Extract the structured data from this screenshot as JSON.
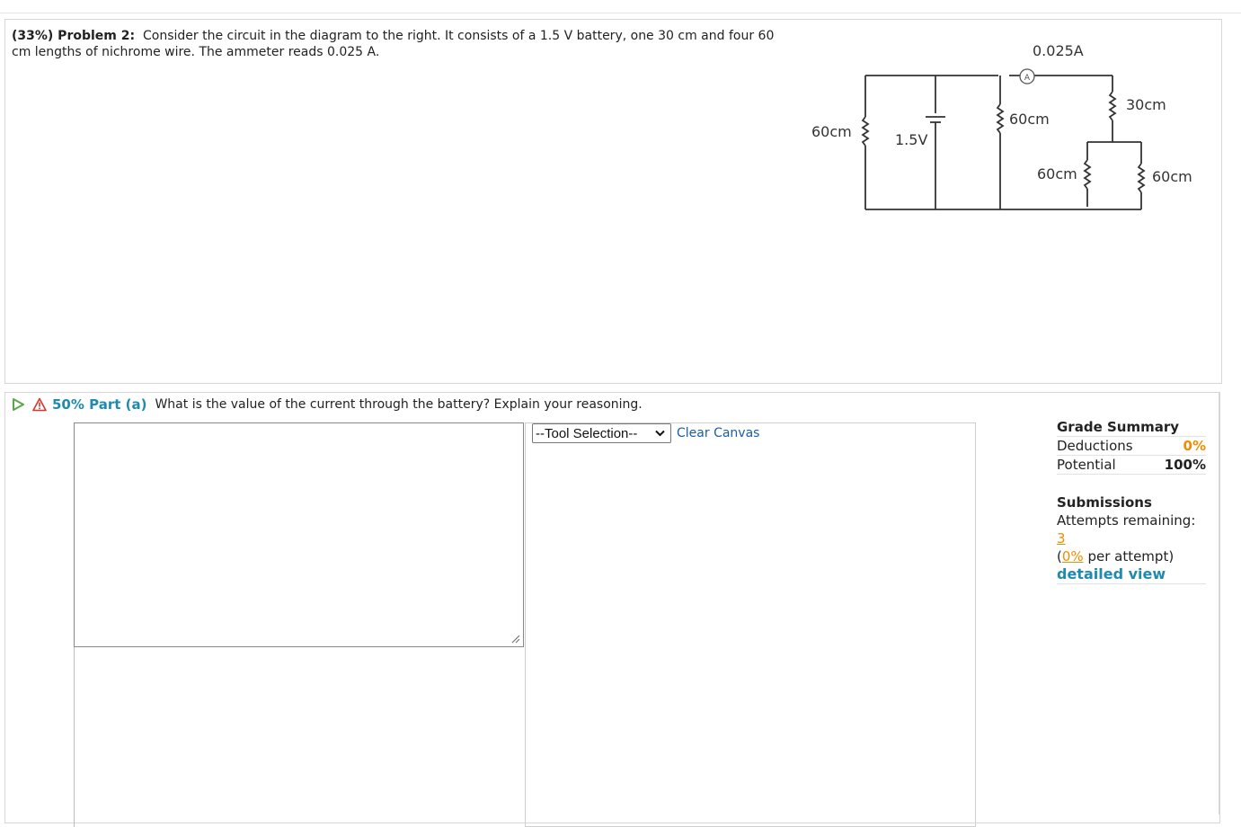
{
  "problem": {
    "prefix": "(33%) Problem 2:",
    "text": "Consider the circuit in the diagram to the right. It consists of a 1.5 V battery, one 30 cm and four 60 cm lengths of nichrome wire. The ammeter reads 0.025 A."
  },
  "circuit": {
    "ammeter_reading": "0.025A",
    "ammeter_symbol": "A",
    "battery_label": "1.5V",
    "left_resistor": "60cm",
    "middle_resistor": "60cm",
    "top_right_resistor": "30cm",
    "bottom_mid_resistor": "60cm",
    "bottom_right_resistor": "60cm"
  },
  "part_a": {
    "weight": "50%",
    "label": "50% Part (a)",
    "question": "What is the value of the current through the battery? Explain your reasoning.",
    "answer_value": ""
  },
  "canvas_tools": {
    "selected_tool": "--Tool Selection--",
    "clear_label": "Clear Canvas"
  },
  "grade_summary": {
    "title": "Grade Summary",
    "deductions_label": "Deductions",
    "deductions_value": "0%",
    "potential_label": "Potential",
    "potential_value": "100%"
  },
  "submissions": {
    "title": "Submissions",
    "attempts_label": "Attempts remaining:",
    "attempts_value": "3",
    "per_attempt_value": "0%",
    "per_attempt_suffix": "per attempt)",
    "detailed_view": "detailed view"
  },
  "colors": {
    "link_blue": "#1f8ab0",
    "orange": "#f08c00",
    "warning_red": "#d9342b",
    "play_green": "#5aa64b"
  },
  "icons": {
    "play": "play-triangle-icon",
    "warning": "warning-triangle-icon",
    "dropdown": "chevron-down-icon"
  }
}
